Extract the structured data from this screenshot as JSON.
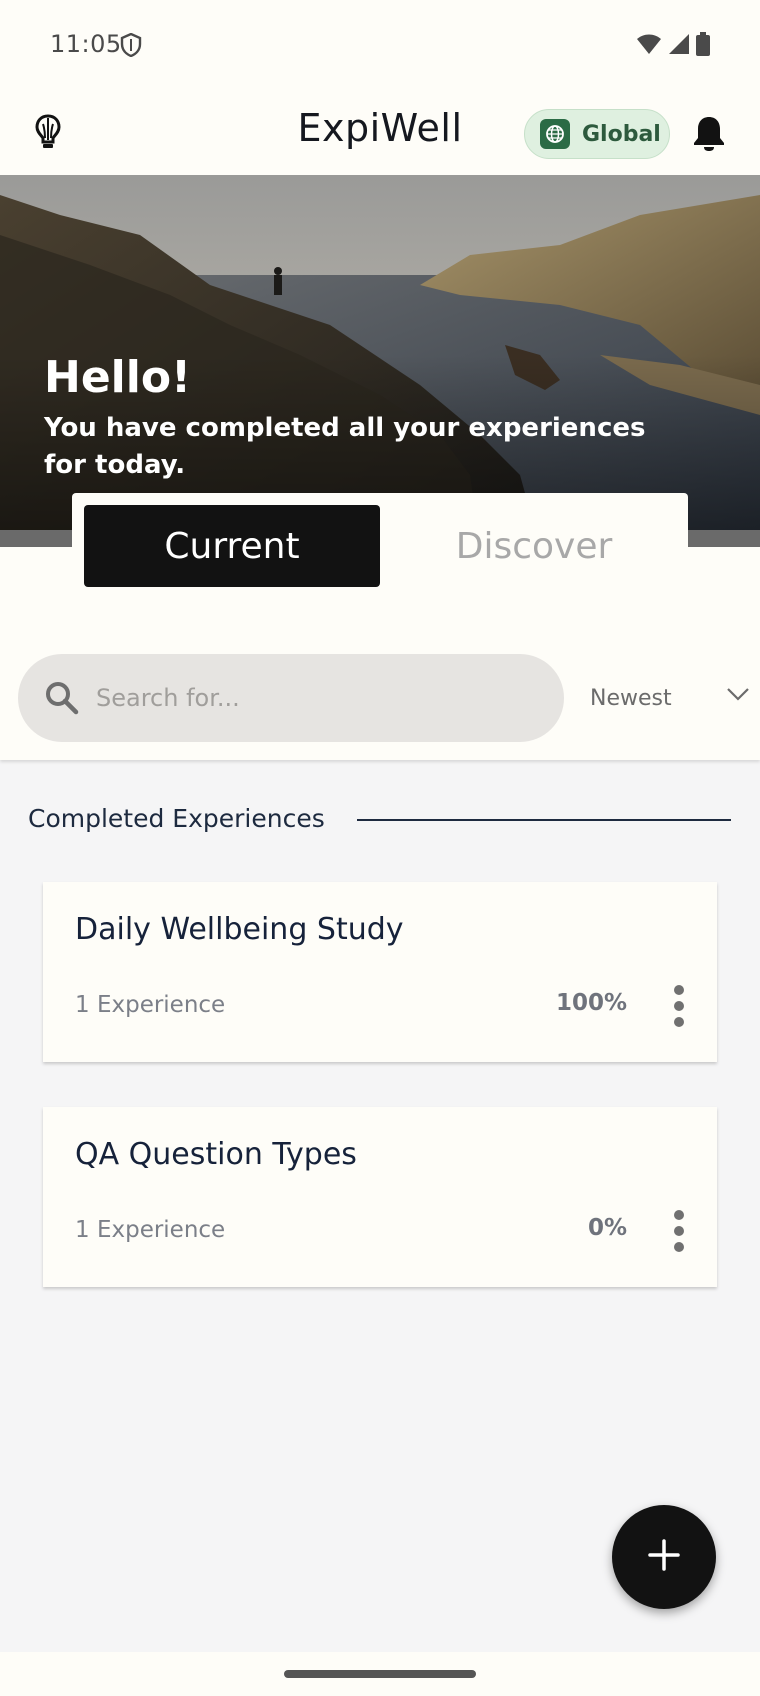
{
  "status_bar": {
    "time": "11:05",
    "icons": [
      "shield-icon",
      "wifi-icon",
      "signal-icon",
      "battery-icon"
    ]
  },
  "app_bar": {
    "title": "ExpiWell",
    "region_chip": {
      "label": "Global",
      "icon": "globe-icon"
    },
    "left_icon": "lightbulb-icon",
    "right_icon": "bell-icon"
  },
  "hero": {
    "greeting": "Hello!",
    "message": "You have completed all your experiences for today."
  },
  "tabs": {
    "current": "Current",
    "discover": "Discover",
    "active": "Current"
  },
  "search": {
    "placeholder": "Search for...",
    "value": ""
  },
  "sort": {
    "selected": "Newest"
  },
  "section": {
    "heading": "Completed Experiences"
  },
  "studies": [
    {
      "title": "Daily Wellbeing Study",
      "count": "1 Experience",
      "progress": "100%"
    },
    {
      "title": "QA Question Types",
      "count": "1 Experience",
      "progress": "0%"
    }
  ],
  "fab": {
    "icon": "plus-icon"
  },
  "colors": {
    "background": "#f5f5f6",
    "surface": "#fefdf8",
    "primary_dark": "#121212",
    "chip_bg": "#dff0e0",
    "chip_accent": "#2b6b45",
    "text_dark": "#16223a"
  }
}
